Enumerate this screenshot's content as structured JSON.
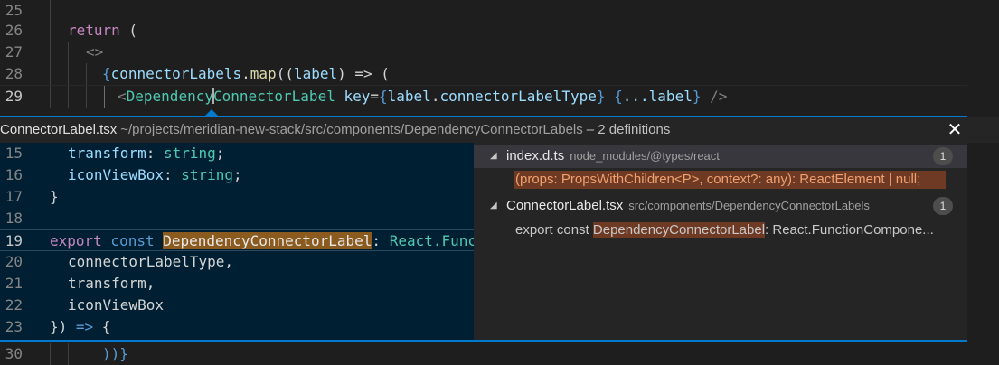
{
  "top_editor": {
    "lines": [
      {
        "num": "25"
      },
      {
        "num": "26",
        "kw": "return",
        "p": " ("
      },
      {
        "num": "27",
        "frag": "<>"
      },
      {
        "num": "28",
        "b1": "{",
        "v1": "connectorLabels",
        "d1": ".",
        "fn": "map",
        "p1": "((",
        "v2": "label",
        "p2": ") => ("
      },
      {
        "num": "29",
        "lt": "<",
        "tag_a": "Dependency",
        "tag_b": "ConnectorLabel",
        "attr": " key",
        "eq": "=",
        "b1": "{",
        "v1": "label",
        "d1": ".",
        "v2": "connectorLabelType",
        "b2": "}",
        "sp": " ",
        "b3": "{",
        "spread": "...label",
        "b4": "}",
        "end": " />"
      }
    ]
  },
  "peek": {
    "file": "ConnectorLabel.tsx",
    "path": "~/projects/meridian-new-stack/src/components/DependencyConnectorLabels",
    "meta": "– 2 definitions",
    "close_glyph": "✕",
    "code_lines": [
      {
        "num": "15",
        "v": "transform",
        "c": ": ",
        "t": "string",
        "e": ";"
      },
      {
        "num": "16",
        "v": "iconViewBox",
        "c": ": ",
        "t": "string",
        "e": ";"
      },
      {
        "num": "17",
        "x": "}"
      },
      {
        "num": "18"
      },
      {
        "num": "19",
        "k1": "export",
        "k2": " const ",
        "m": "DependencyConnectorLabel",
        "c": ": ",
        "t": "React.Funct"
      },
      {
        "num": "20",
        "v": "connectorLabelType",
        "e": ","
      },
      {
        "num": "21",
        "v": "transform",
        "e": ","
      },
      {
        "num": "22",
        "v": "iconViewBox"
      },
      {
        "num": "23",
        "x": "})",
        "a": " => ",
        "x2": "{"
      }
    ],
    "refs": [
      {
        "file": "index.d.ts",
        "dir": "node_modules/@types/react",
        "count": "1",
        "line": "(props: PropsWithChildren<P>, context?: any): ReactElement | null;"
      },
      {
        "file": "ConnectorLabel.tsx",
        "dir": "src/components/DependencyConnectorLabels",
        "count": "1",
        "pre": "export const ",
        "hit": "DependencyConnectorLabel",
        "post": ": React.FunctionCompone..."
      }
    ]
  },
  "bottom_editor": {
    "num": "30",
    "text": "))}"
  },
  "colors": {
    "accent": "#007acc",
    "peek_bg": "#001f33",
    "match": "#8a5a1e"
  }
}
